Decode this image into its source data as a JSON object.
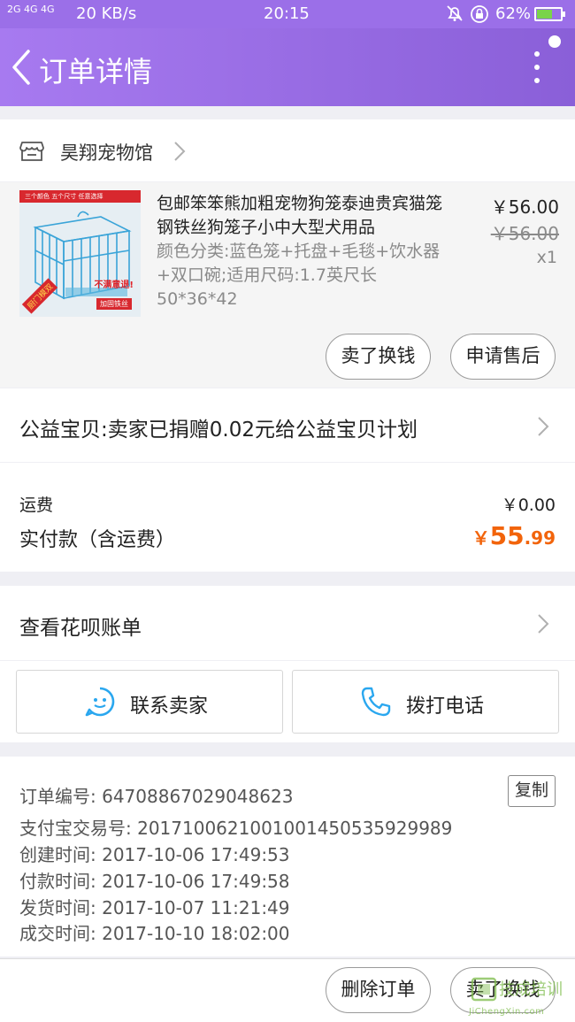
{
  "status_bar": {
    "signal": "2G 4G 4G",
    "network_speed": "20 KB/s",
    "time": "20:15",
    "battery": "62%",
    "battery_level": 0.62,
    "icons": [
      "signal-icon",
      "mute-bell-icon",
      "rotation-lock-icon",
      "battery-icon"
    ]
  },
  "header": {
    "title": "订单详情",
    "back_icon": "chevron-left-icon",
    "more_icon": "more-vertical-icon"
  },
  "store": {
    "name": "昊翔宠物馆",
    "icon": "store-icon"
  },
  "product": {
    "image_caption": "三个颜色  五个尺寸  任意选择",
    "image_promo_1": "厨门模双",
    "image_promo_2": "不满意退!",
    "image_promo_3": "加固铁丝",
    "title": "包邮笨笨熊加粗宠物狗笼泰迪贵宾猫笼钢铁丝狗笼子小中大型犬用品",
    "spec": "颜色分类:蓝色笼+托盘+毛毯+饮水器+双口碗;适用尺码:1.7英尺长50*36*42",
    "price": "￥56.00",
    "original_price": "￥56.00",
    "quantity": "x1",
    "sell_button": "卖了换钱",
    "after_sale_button": "申请售后"
  },
  "charity": {
    "text": "公益宝贝:卖家已捐赠0.02元给公益宝贝计划"
  },
  "fees": {
    "shipping_label": "运费",
    "shipping_value": "￥0.00",
    "paid_label": "实付款（含运费）",
    "paid_symbol": "￥",
    "paid_integer": "55",
    "paid_decimal": ".99",
    "paid_color": "#f2640b"
  },
  "huabei": {
    "text": "查看花呗账单"
  },
  "contact": {
    "seller_label": "联系卖家",
    "call_label": "拨打电话"
  },
  "order_info": {
    "order_no": "订单编号: 64708867029048623",
    "copy_button": "复制",
    "alipay_no": "支付宝交易号: 2017100621001001450535929989",
    "created": "创建时间: 2017-10-06 17:49:53",
    "paid": "付款时间: 2017-10-06 17:49:58",
    "shipped": "发货时间: 2017-10-07 11:21:49",
    "completed": "成交时间: 2017-10-10 18:02:00"
  },
  "bottom_bar": {
    "delete_button": "删除订单",
    "sell_button": "卖了换钱"
  },
  "watermark": {
    "brand": "技成培训",
    "url": "JiChengXin.com"
  },
  "colors": {
    "header": "#9b6fe8",
    "accent_price": "#f2640b",
    "contact_icon": "#2aa7ef"
  }
}
